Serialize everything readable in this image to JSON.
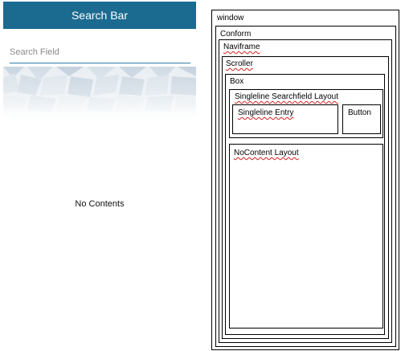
{
  "phone": {
    "title": "Search Bar",
    "search_placeholder": "Search Field",
    "search_value": "",
    "empty_message": "No Contents",
    "colors": {
      "titlebar": "#1b6a90",
      "underline": "#2f7ea3"
    }
  },
  "hierarchy": {
    "window": "window",
    "conform": "Conform",
    "naviframe": "Naviframe",
    "scroller": "Scroller",
    "box": "Box",
    "searchfield_layout": "Singleline Searchfield Layout",
    "entry": "Singleline Entry",
    "button": "Button",
    "nocontent_layout": "NoContent Layout"
  }
}
